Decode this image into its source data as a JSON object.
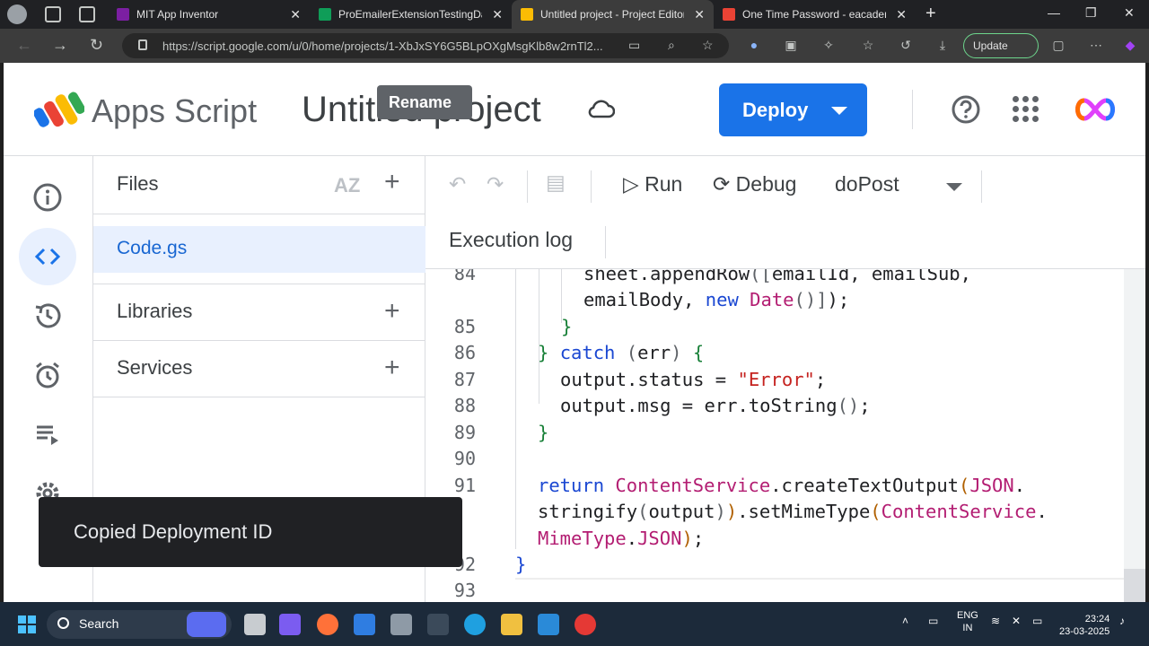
{
  "browser": {
    "tabs": [
      {
        "title": "MIT App Inventor",
        "favicon": "mit-app-inventor-icon",
        "color": "#7b1fa2"
      },
      {
        "title": "ProEmailerExtensionTestingDataB",
        "favicon": "google-sheets-icon",
        "color": "#0f9d58"
      },
      {
        "title": "Untitled project - Project Editor -",
        "favicon": "apps-script-icon",
        "color": "#fbbc04",
        "active": true
      },
      {
        "title": "One Time Password - eacademy.t",
        "favicon": "gmail-icon",
        "color": "#ea4335"
      }
    ],
    "url": "https://script.google.com/u/0/home/projects/1-XbJxSY6G5BLpOXgMsgKlb8w2rnTl2...",
    "update_label": "Update"
  },
  "header": {
    "app_name": "Apps Script",
    "project_title": "Untitled project",
    "deploy_label": "Deploy"
  },
  "tooltip": "Rename",
  "files_panel": {
    "heading": "Files",
    "sort_icon": "AZ",
    "files": [
      "Code.gs"
    ],
    "libraries_label": "Libraries",
    "services_label": "Services"
  },
  "editor_toolbar": {
    "run_label": "Run",
    "debug_label": "Debug",
    "function_name": "doPost",
    "execution_log_label": "Execution log"
  },
  "code": {
    "line_numbers": [
      "84",
      "85",
      "86",
      "87",
      "88",
      "89",
      "90",
      "91",
      "92",
      "93"
    ]
  },
  "snackbar": "Copied Deployment ID",
  "taskbar": {
    "search_label": "Search",
    "lang_top": "ENG",
    "lang_bottom": "IN",
    "time": "23:24",
    "date": "23-03-2025"
  },
  "colors": {
    "accent": "#1a73e8",
    "keyword": "#1a47d2",
    "string": "#c5221f",
    "class": "#b31d72"
  }
}
